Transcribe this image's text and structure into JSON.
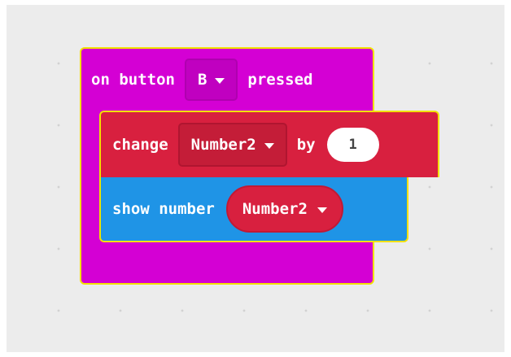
{
  "event_block": {
    "prefix": "on button",
    "button_value": "B",
    "suffix": "pressed"
  },
  "change_block": {
    "prefix": "change",
    "variable": "Number2",
    "connector": "by",
    "amount": "1"
  },
  "show_block": {
    "prefix": "show number",
    "variable": "Number2"
  },
  "colors": {
    "event": "#d400d4",
    "variables": "#d8203f",
    "basic": "#1f94e6",
    "highlight": "#f2e100",
    "workspace": "#ececec"
  },
  "icons": [
    "dropdown-caret-icon"
  ]
}
